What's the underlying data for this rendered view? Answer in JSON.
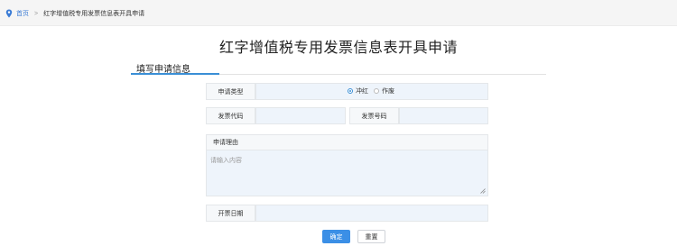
{
  "breadcrumb": {
    "home": "首页",
    "separator": ">",
    "current": "红字增值税专用发票信息表开具申请"
  },
  "page_title": "红字增值税专用发票信息表开具申请",
  "section_title": "填写申请信息",
  "form": {
    "apply_type_label": "申请类型",
    "apply_type_options": [
      {
        "label": "冲红",
        "selected": true
      },
      {
        "label": "作废",
        "selected": false
      }
    ],
    "invoice_code_label": "发票代码",
    "invoice_code_value": "",
    "invoice_number_label": "发票号码",
    "invoice_number_value": "",
    "reason_label": "申请理由",
    "reason_placeholder": "请输入内容",
    "issue_date_label": "开票日期",
    "issue_date_value": ""
  },
  "buttons": {
    "confirm": "确定",
    "reset": "重置"
  },
  "colors": {
    "accent": "#3a8fd6",
    "primary_button": "#3b8fe6",
    "field_bg": "#eef4fb"
  }
}
